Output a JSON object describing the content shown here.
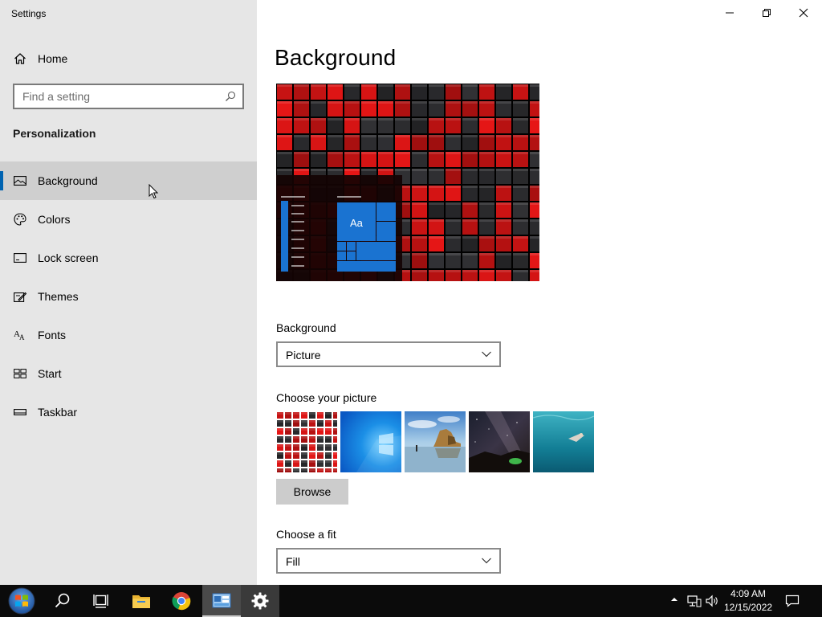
{
  "window": {
    "title": "Settings"
  },
  "sidebar": {
    "home_label": "Home",
    "search_placeholder": "Find a setting",
    "section_title": "Personalization",
    "items": [
      {
        "label": "Background",
        "icon": "picture-icon",
        "active": true
      },
      {
        "label": "Colors",
        "icon": "palette-icon",
        "active": false
      },
      {
        "label": "Lock screen",
        "icon": "lock-screen-icon",
        "active": false
      },
      {
        "label": "Themes",
        "icon": "themes-icon",
        "active": false
      },
      {
        "label": "Fonts",
        "icon": "fonts-icon",
        "active": false
      },
      {
        "label": "Start",
        "icon": "start-icon",
        "active": false
      },
      {
        "label": "Taskbar",
        "icon": "taskbar-icon",
        "active": false
      }
    ]
  },
  "main": {
    "title": "Background",
    "preview_tile_text": "Aa",
    "background_label": "Background",
    "background_value": "Picture",
    "choose_picture_label": "Choose your picture",
    "browse_label": "Browse",
    "choose_fit_label": "Choose a fit",
    "fit_value": "Fill"
  },
  "taskbar": {
    "time": "4:09 AM",
    "date": "12/15/2022",
    "apps": [
      "start-orb-icon",
      "search-icon",
      "task-view-icon",
      "file-explorer-icon",
      "chrome-icon",
      "control-panel-icon",
      "settings-gear-icon"
    ]
  },
  "colors": {
    "accent": "#0063b1",
    "sidebar_bg": "#e6e6e6",
    "taskbar_bg": "#0b0b0b"
  }
}
